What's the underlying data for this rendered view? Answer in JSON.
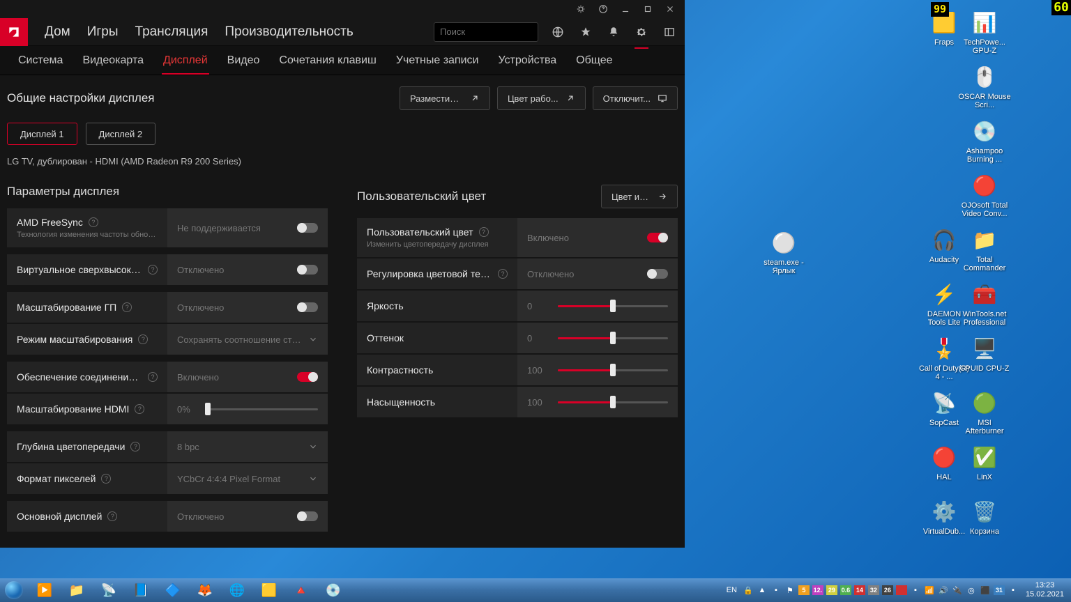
{
  "titlebar": {
    "bug": "bug-icon",
    "help": "help-icon",
    "min": "minimize-icon",
    "max": "maximize-icon",
    "close": "close-icon"
  },
  "nav": {
    "home": "Дом",
    "games": "Игры",
    "stream": "Трансляция",
    "perf": "Производительность",
    "search_placeholder": "Поиск"
  },
  "subnav": {
    "system": "Система",
    "gpu": "Видеокарта",
    "display": "Дисплей",
    "video": "Видео",
    "hotkeys": "Сочетания клавиш",
    "accounts": "Учетные записи",
    "devices": "Устройства",
    "general": "Общее"
  },
  "section": {
    "title": "Общие настройки дисплея",
    "arrange": "Разместить д...",
    "workspace": "Цвет рабо...",
    "disable": "Отключит..."
  },
  "displays": {
    "d1": "Дисплей 1",
    "d2": "Дисплей 2",
    "info": "LG TV, дублирован - HDMI (AMD Radeon R9 200 Series)"
  },
  "left": {
    "title": "Параметры дисплея",
    "freesync": {
      "label": "AMD FreeSync",
      "sub": "Технология изменения частоты обновл...",
      "status": "Не поддерживается"
    },
    "vsr": {
      "label": "Виртуальное сверхвысокое разр...",
      "status": "Отключено"
    },
    "gpuscale": {
      "label": "Масштабирование ГП",
      "status": "Отключено"
    },
    "scalemode": {
      "label": "Режим масштабирования",
      "status": "Сохранять соотношение сторон"
    },
    "hdmilink": {
      "label": "Обеспечение соединения HDMI",
      "status": "Включено"
    },
    "hdmiscale": {
      "label": "Масштабирование HDMI",
      "status": "0%"
    },
    "depth": {
      "label": "Глубина цветопередачи",
      "status": "8 bpc"
    },
    "pixfmt": {
      "label": "Формат пикселей",
      "status": "YCbCr 4:4:4 Pixel Format"
    },
    "primary": {
      "label": "Основной дисплей",
      "status": "Отключено"
    }
  },
  "right": {
    "title": "Пользовательский цвет",
    "gamecolor": "Цвет игры",
    "custom": {
      "label": "Пользовательский цвет",
      "sub": "Изменить цветопередачу дисплея",
      "status": "Включено"
    },
    "temp": {
      "label": "Регулировка цветовой температ...",
      "status": "Отключено"
    },
    "bright": {
      "label": "Яркость",
      "value": "0"
    },
    "hue": {
      "label": "Оттенок",
      "value": "0"
    },
    "contrast": {
      "label": "Контрастность",
      "value": "100"
    },
    "sat": {
      "label": "Насыщенность",
      "value": "100"
    }
  },
  "overlay": {
    "fraps": "99",
    "fps": "60"
  },
  "desktop_icons": [
    {
      "label": "Fraps",
      "col": 0,
      "row": 0,
      "glyph": "🟨"
    },
    {
      "label": "TechPowe... GPU-Z",
      "col": 1,
      "row": 0,
      "glyph": "📊"
    },
    {
      "label": "OSCAR Mouse Scri...",
      "col": 1,
      "row": 1,
      "glyph": "🖱️"
    },
    {
      "label": "Ashampoo Burning ...",
      "col": 1,
      "row": 2,
      "glyph": "💿"
    },
    {
      "label": "OJOsoft Total Video Conv...",
      "col": 1,
      "row": 3,
      "glyph": "🔴"
    },
    {
      "label": "Audacity",
      "col": 0,
      "row": 4,
      "glyph": "🎧"
    },
    {
      "label": "Total Commander",
      "col": 1,
      "row": 4,
      "glyph": "📁"
    },
    {
      "label": "DAEMON Tools Lite",
      "col": 0,
      "row": 5,
      "glyph": "⚡"
    },
    {
      "label": "WinTools.net Professional",
      "col": 1,
      "row": 5,
      "glyph": "🧰"
    },
    {
      "label": "Call of Duty(R) 4 - ...",
      "col": 0,
      "row": 6,
      "glyph": "🎖️"
    },
    {
      "label": "CPUID CPU-Z",
      "col": 1,
      "row": 6,
      "glyph": "🖥️"
    },
    {
      "label": "SopCast",
      "col": 0,
      "row": 7,
      "glyph": "📡"
    },
    {
      "label": "MSI Afterburner",
      "col": 1,
      "row": 7,
      "glyph": "🟢"
    },
    {
      "label": "HAL",
      "col": 0,
      "row": 8,
      "glyph": "🔴"
    },
    {
      "label": "LinX",
      "col": 1,
      "row": 8,
      "glyph": "✅"
    },
    {
      "label": "VirtualDub...",
      "col": 0,
      "row": 9,
      "glyph": "⚙️"
    },
    {
      "label": "Корзина",
      "col": 1,
      "row": 9,
      "glyph": "🗑️"
    }
  ],
  "steam_icon": {
    "label": "steam.exe - Ярлык",
    "glyph": "⚪"
  },
  "task_items": [
    {
      "name": "media-player",
      "glyph": "▶️"
    },
    {
      "name": "explorer",
      "glyph": "📁"
    },
    {
      "name": "sopcast",
      "glyph": "📡"
    },
    {
      "name": "word",
      "glyph": "📘"
    },
    {
      "name": "app1",
      "glyph": "🔷"
    },
    {
      "name": "firefox",
      "glyph": "🦊"
    },
    {
      "name": "chrome",
      "glyph": "🌐"
    },
    {
      "name": "fraps",
      "glyph": "🟨"
    },
    {
      "name": "amd",
      "glyph": "🔺"
    },
    {
      "name": "disc",
      "glyph": "💿"
    }
  ],
  "tray": {
    "lang": "EN",
    "badges": [
      {
        "t": "5",
        "c": "#f0a020"
      },
      {
        "t": "12.",
        "c": "#c040c0"
      },
      {
        "t": "29",
        "c": "#d0d040"
      },
      {
        "t": "0.6",
        "c": "#50b050"
      },
      {
        "t": "14",
        "c": "#d03030"
      },
      {
        "t": "32",
        "c": "#808080"
      },
      {
        "t": "26",
        "c": "#404040"
      },
      {
        "t": "",
        "c": "#d03030"
      }
    ],
    "time": "13:23",
    "date": "15.02.2021",
    "num": "31"
  }
}
